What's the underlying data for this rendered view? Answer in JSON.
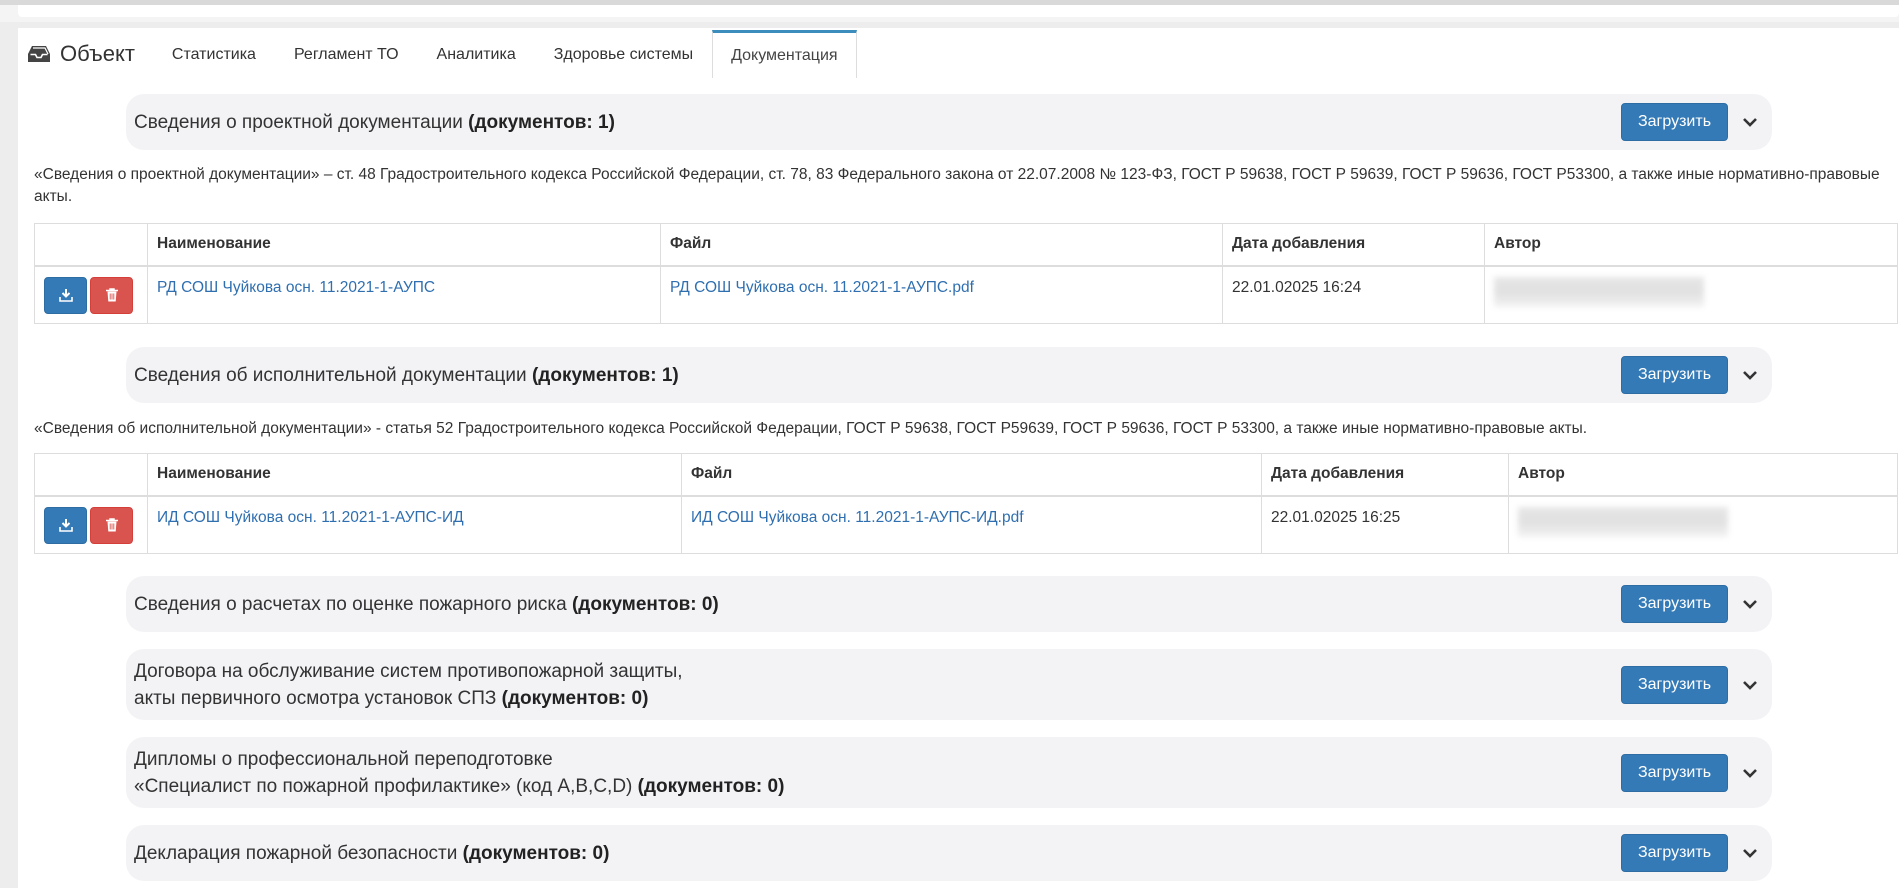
{
  "app": {
    "title": "Объект"
  },
  "tabs": [
    {
      "label": "Статистика"
    },
    {
      "label": "Регламент ТО"
    },
    {
      "label": "Аналитика"
    },
    {
      "label": "Здоровье системы"
    },
    {
      "label": "Документация"
    }
  ],
  "upload_label": "Загрузить",
  "sections": [
    {
      "title": "Сведения о проектной документации",
      "count": "(документов: 1)",
      "note": "«Сведения о проектной документации» – ст. 48 Градостроительного кодекса Российской Федерации, ст. 78, 83 Федерального закона от 22.07.2008 № 123-ФЗ, ГОСТ Р 59638, ГОСТ Р 59639, ГОСТ Р 59636, ГОСТ Р53300, а также иные нормативно-правовые акты.",
      "columns": [
        "",
        "Наименование",
        "Файл",
        "Дата добавления",
        "Автор"
      ],
      "rows": [
        {
          "name": "РД СОШ Чуйкова осн. 11.2021-1-АУПС",
          "file": "РД СОШ Чуйкова осн. 11.2021-1-АУПС.pdf",
          "date": "22.01.02025 16:24"
        }
      ]
    },
    {
      "title": "Сведения об исполнительной документации",
      "count": "(документов: 1)",
      "note": "«Сведения об исполнительной документации» - статья 52 Градостроительного кодекса Российской Федерации, ГОСТ Р 59638, ГОСТ Р59639, ГОСТ Р 59636, ГОСТ Р 53300, а также иные нормативно-правовые акты.",
      "columns": [
        "",
        "Наименование",
        "Файл",
        "Дата добавления",
        "Автор"
      ],
      "rows": [
        {
          "name": "ИД СОШ Чуйкова осн. 11.2021-1-АУПС-ИД",
          "file": "ИД СОШ Чуйкова осн. 11.2021-1-АУПС-ИД.pdf",
          "date": "22.01.02025 16:25"
        }
      ]
    },
    {
      "title": "Сведения о расчетах по оценке пожарного риска",
      "count": "(документов: 0)"
    },
    {
      "title_line1": "Договора на обслуживание систем противопожарной защиты,",
      "title_line2": "акты первичного осмотра установок СПЗ",
      "count": "(документов: 0)"
    },
    {
      "title_line1": "Дипломы о профессиональной переподготовке",
      "title_line2": "«Специалист по пожарной профилактике» (код А,B,C,D)",
      "count": "(документов: 0)"
    },
    {
      "title": "Декларация пожарной безопасности",
      "count": "(документов: 0)"
    }
  ],
  "colors": {
    "primary": "#337ab7",
    "danger": "#d9534f",
    "link": "#2f6fb0",
    "section_bg": "#f3f3f6",
    "tab_active": "#3c8dbc"
  },
  "icons": {
    "brand": "inbox-icon",
    "download": "download-icon",
    "delete": "trash-icon",
    "toggle": "chevron-down-icon"
  }
}
